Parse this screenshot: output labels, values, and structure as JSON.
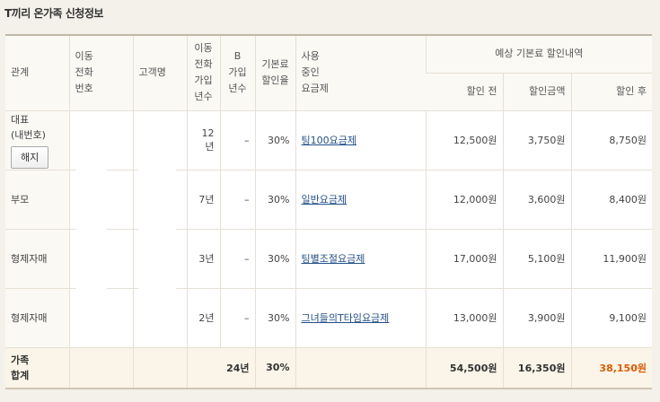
{
  "title": "T끼리 온가족 신청정보",
  "headers": {
    "relation": "관계",
    "phone": "이동\n전화\n번호",
    "name": "고객명",
    "years": "이동\n전화\n가입\n년수",
    "b_years": "B\n가입\n년수",
    "rate": "기본료\n할인율",
    "plan": "사용\n중인\n요금제",
    "expected": "예상 기본료 할인내역",
    "before": "할인 전",
    "amount": "할인금액",
    "after": "할인 후"
  },
  "rows": [
    {
      "relation": "대표\n(내번호)",
      "button": "해지",
      "years": "12년",
      "b_years": "–",
      "rate": "30%",
      "plan": "팅100요금제",
      "before": "12,500원",
      "amount": "3,750원",
      "after": "8,750원"
    },
    {
      "relation": "부모",
      "years": "7년",
      "b_years": "–",
      "rate": "30%",
      "plan": "일반요금제",
      "before": "12,000원",
      "amount": "3,600원",
      "after": "8,400원"
    },
    {
      "relation": "형제자매",
      "years": "3년",
      "b_years": "–",
      "rate": "30%",
      "plan": "팅별조절요금제",
      "before": "17,000원",
      "amount": "5,100원",
      "after": "11,900원"
    },
    {
      "relation": "형제자매",
      "years": "2년",
      "b_years": "–",
      "rate": "30%",
      "plan": "그녀들의T타임요금제",
      "before": "13,000원",
      "amount": "3,900원",
      "after": "9,100원"
    }
  ],
  "total": {
    "label": "가족\n합계",
    "years": "24년",
    "rate": "30%",
    "before": "54,500원",
    "amount": "16,350원",
    "after": "38,150원"
  },
  "colors": {
    "total_after": "#e05a00",
    "plan_link": "#22508a"
  }
}
